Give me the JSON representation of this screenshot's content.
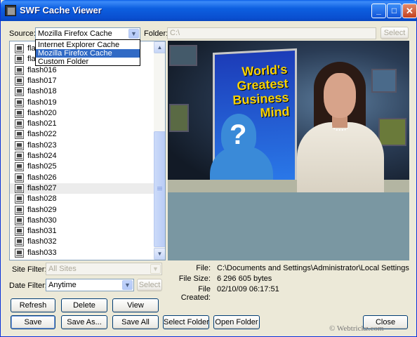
{
  "window": {
    "title": "SWF Cache Viewer"
  },
  "source": {
    "label": "Source:",
    "selected": "Mozilla Firefox Cache",
    "options": [
      "Internet Explorer Cache",
      "Mozilla Firefox Cache",
      "Custom Folder"
    ],
    "highlighted_option": "Mozilla Firefox Cache"
  },
  "folder": {
    "label": "Folder:",
    "value": "C:\\",
    "select_label": "Select"
  },
  "files": {
    "items": [
      "flash014",
      "flash015",
      "flash016",
      "flash017",
      "flash018",
      "flash019",
      "flash020",
      "flash021",
      "flash022",
      "flash023",
      "flash024",
      "flash025",
      "flash026",
      "flash027",
      "flash028",
      "flash029",
      "flash030",
      "flash031",
      "flash032",
      "flash033"
    ],
    "visible_prefix_items": [
      "flash",
      "flash"
    ],
    "selected": "flash027"
  },
  "filters": {
    "site_label": "Site Filter:",
    "site_value": "All Sites",
    "date_label": "Date Filter:",
    "date_value": "Anytime",
    "date_select_label": "Select"
  },
  "preview": {
    "sign_line1": "World's",
    "sign_line2": "Greatest",
    "sign_line3": "Business",
    "sign_line4": "Mind",
    "sign_symbol": "?"
  },
  "info": {
    "file_label": "File:",
    "file_value": "C:\\Documents and Settings\\Administrator\\Local Settings\\Application",
    "size_label": "File Size:",
    "size_value": "6 296 605 bytes",
    "created_label": "File Created:",
    "created_value": "02/10/09 06:17:51"
  },
  "buttons": {
    "refresh": "Refresh",
    "delete": "Delete",
    "view": "View",
    "save": "Save",
    "save_as": "Save As...",
    "save_all": "Save All",
    "select_folder": "Select Folder",
    "open_folder": "Open Folder",
    "close": "Close"
  },
  "watermark": "© Webtrickz.com",
  "colors": {
    "titlebar": "#0a5fe8",
    "selection": "#316ac5",
    "window_bg": "#ece9d8"
  }
}
